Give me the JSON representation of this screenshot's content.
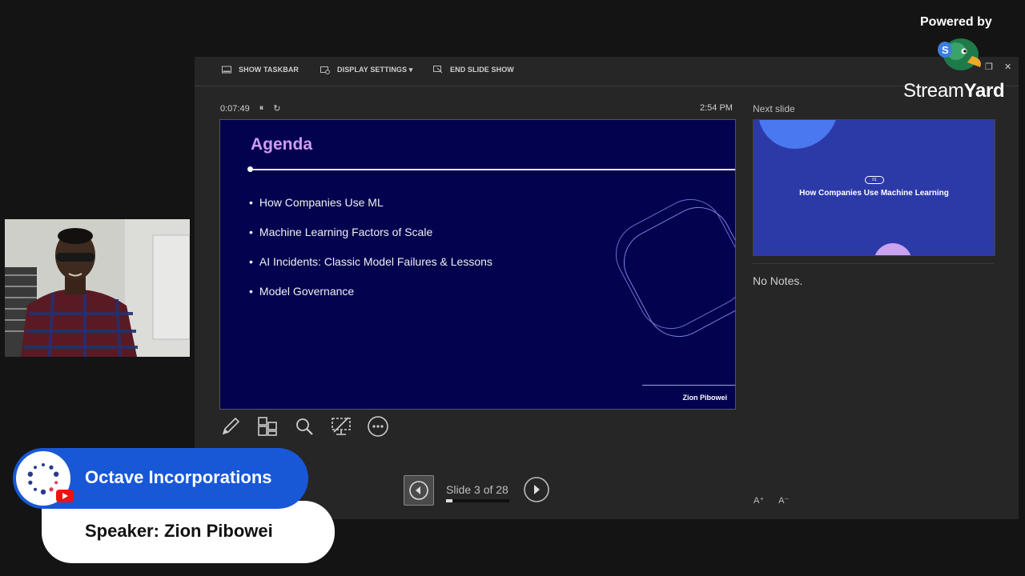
{
  "presenter": {
    "toolbar": {
      "show_taskbar": "SHOW TASKBAR",
      "display_settings": "DISPLAY SETTINGS ▾",
      "end_slide_show": "END SLIDE SHOW"
    },
    "timer": "0:07:49",
    "clock": "2:54 PM",
    "next_slide_label": "Next slide",
    "current_slide": {
      "title": "Agenda",
      "bullets": [
        "How Companies Use ML",
        "Machine Learning Factors of Scale",
        "AI Incidents: Classic Model Failures & Lessons",
        "Model Governance"
      ],
      "author": "Zion Pibowei",
      "background": "#02024f",
      "title_color": "#cf9cf2"
    },
    "next_slide": {
      "pill": "01",
      "title": "How Companies Use Machine Learning"
    },
    "notes": "No Notes.",
    "font_controls": [
      "A⁺",
      "A⁻"
    ],
    "tools": [
      "pen-icon",
      "see-all-slides-icon",
      "zoom-icon",
      "black-screen-icon",
      "more-options-icon"
    ],
    "navigation": {
      "slide_count": "Slide 3 of 28",
      "progress": 0.107
    }
  },
  "streamyard": {
    "powered_by": "Powered by",
    "brand_light": "Stream",
    "brand_bold": "Yard"
  },
  "banner": {
    "channel": "Octave Incorporations",
    "speaker": "Speaker: Zion Pibowei",
    "accent": "#1858d6"
  }
}
